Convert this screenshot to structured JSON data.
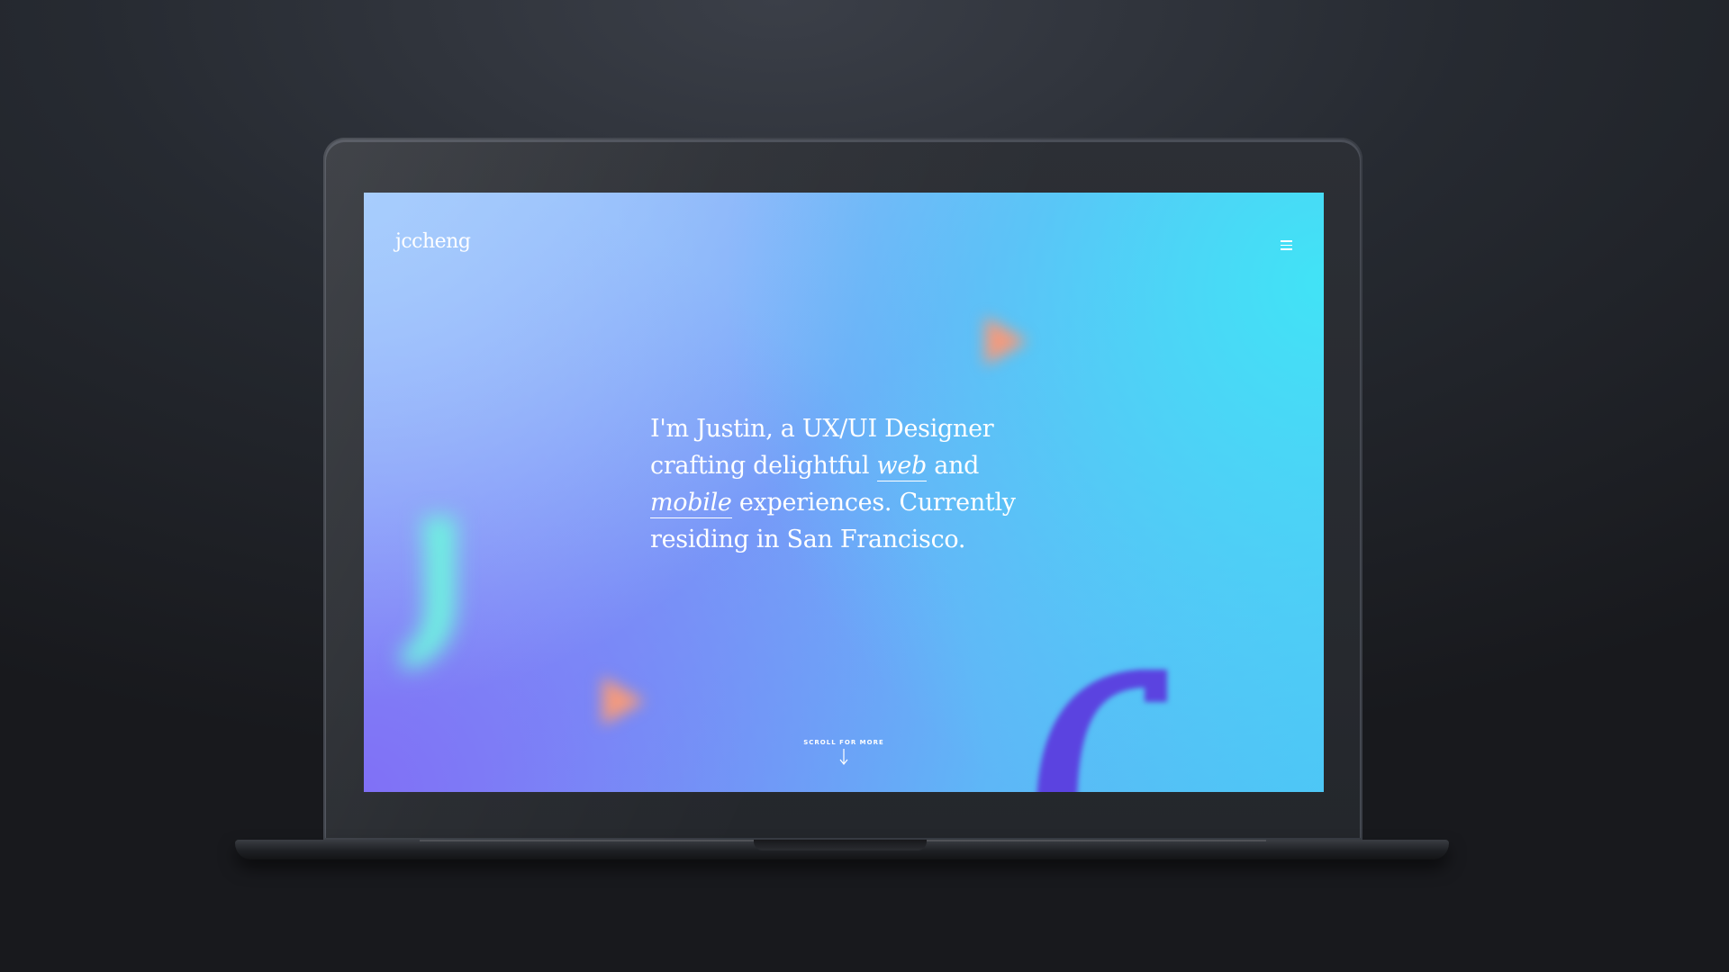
{
  "site": {
    "logo": "jccheng",
    "menu_icon": "hamburger-menu-icon"
  },
  "hero": {
    "line1": "I'm Justin, a UX/UI Designer",
    "line2_prefix": "crafting delightful ",
    "link_web": "web",
    "line2_suffix": " and",
    "link_mobile": "mobile",
    "line3_suffix": " experiences. Currently",
    "line4": "residing in San Francisco."
  },
  "scroll": {
    "label": "SCROLL FOR MORE",
    "icon": "arrow-down-icon"
  },
  "colors": {
    "accent_cyan": "#41e3f6",
    "accent_violet": "#8070f6",
    "shape_mint": "#6ff0e0",
    "shape_indigo": "#5b43e0",
    "shape_coral": "#f49a7c"
  }
}
